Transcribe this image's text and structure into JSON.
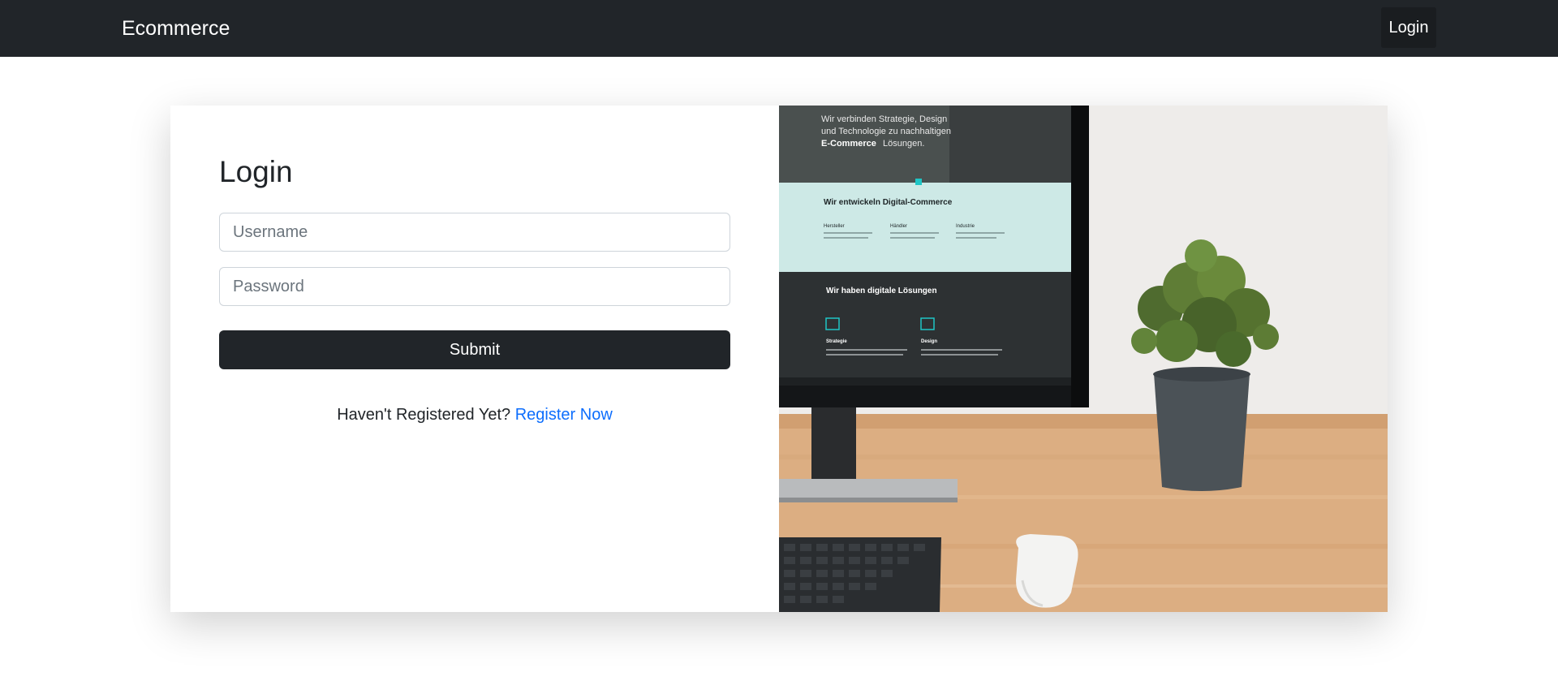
{
  "navbar": {
    "brand": "Ecommerce",
    "login_label": "Login"
  },
  "login": {
    "title": "Login",
    "username_placeholder": "Username",
    "password_placeholder": "Password",
    "submit_label": "Submit",
    "register_prompt": "Haven't Registered Yet?",
    "register_link": "Register Now"
  },
  "hero_image": {
    "screen_tagline_1": "Wir verbinden Strategie, Design",
    "screen_tagline_2": "und Technologie zu nachhaltigen",
    "screen_tagline_3_bold": "E-Commerce",
    "screen_tagline_3_rest": "Lösungen.",
    "screen_section_title": "Wir entwickeln Digital-Commerce",
    "screen_col_1": "Hersteller",
    "screen_col_2": "Händler",
    "screen_col_3": "Industrie",
    "screen_section_title_2": "Wir haben digitale Lösungen",
    "screen_item_1": "Strategie",
    "screen_item_2": "Design"
  },
  "colors": {
    "navbar_bg": "#212529",
    "primary_button": "#212529",
    "link": "#0d6efd"
  }
}
